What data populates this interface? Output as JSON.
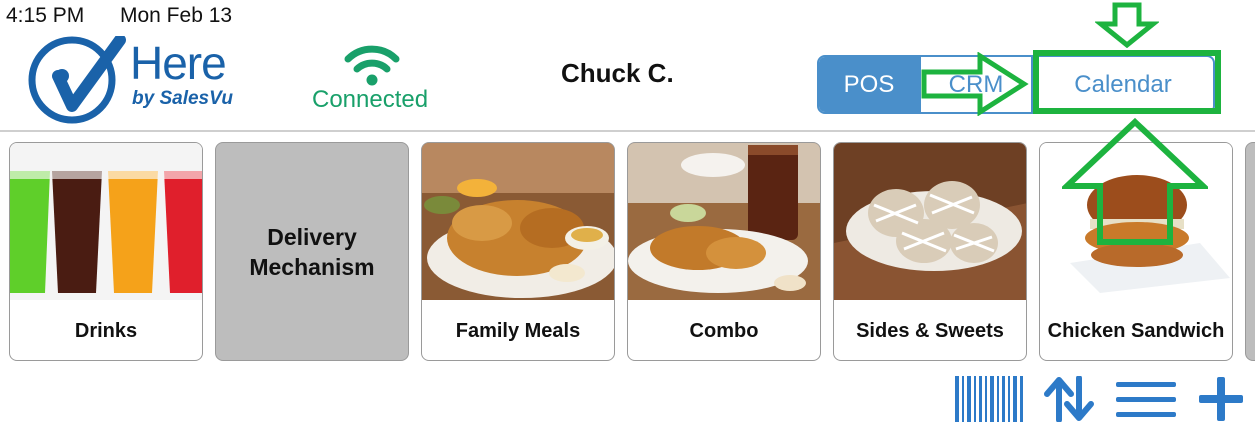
{
  "status_bar": {
    "time": "4:15 PM",
    "date": "Mon Feb 13"
  },
  "logo": {
    "title": "Here",
    "subtitle": "by SalesVu",
    "icon": "checkmark-person-logo-icon",
    "color": "#1a62a9"
  },
  "connection": {
    "icon": "wifi-icon",
    "label": "Connected",
    "color": "#19a06a"
  },
  "user": {
    "name": "Chuck C."
  },
  "mode_tabs": [
    {
      "label": "POS",
      "selected": true
    },
    {
      "label": "CRM",
      "selected": false
    },
    {
      "label": "Calendar",
      "selected": false
    }
  ],
  "accent_color": "#4a8fca",
  "categories": [
    {
      "label": "Drinks",
      "image": "drinks-photo"
    },
    {
      "label": "Delivery Mechanism",
      "image": ""
    },
    {
      "label": "Family Meals",
      "image": "family-meals-photo"
    },
    {
      "label": "Combo",
      "image": "combo-photo"
    },
    {
      "label": "Sides & Sweets",
      "image": "sides-sweets-photo"
    },
    {
      "label": "Chicken Sandwich",
      "image": "chicken-sandwich-photo"
    }
  ],
  "toolbar": {
    "barcode_icon": "barcode-icon",
    "sort_icon": "sort-arrows-icon",
    "menu_icon": "list-menu-icon",
    "add_icon": "plus-icon"
  },
  "annotation_color": "#1db33f"
}
